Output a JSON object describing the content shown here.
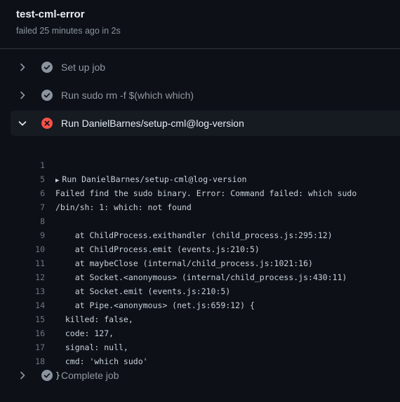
{
  "job": {
    "title": "test-cml-error",
    "subtitle": "failed 25 minutes ago in 2s"
  },
  "steps": [
    {
      "label": "Set up job",
      "status": "success",
      "expanded": false
    },
    {
      "label": "Run sudo rm -f $(which which)",
      "status": "success",
      "expanded": false
    },
    {
      "label": "Run DanielBarnes/setup-cml@log-version",
      "status": "failure",
      "expanded": true
    },
    {
      "label": "Complete job",
      "status": "success",
      "expanded": false
    }
  ],
  "colors": {
    "background": "#0d1117",
    "success_icon": "#8b949e",
    "failure_icon": "#f85149",
    "active_step_bg": "#161b22"
  },
  "log": {
    "group_header": "Run DanielBarnes/setup-cml@log-version",
    "lines": [
      {
        "num": "1",
        "text": "Run DanielBarnes/setup-cml@log-version"
      },
      {
        "num": "5",
        "text": "Failed find the sudo binary. Error: Command failed: which sudo"
      },
      {
        "num": "6",
        "text": "/bin/sh: 1: which: not found"
      },
      {
        "num": "7",
        "text": ""
      },
      {
        "num": "8",
        "text": "    at ChildProcess.exithandler (child_process.js:295:12)"
      },
      {
        "num": "9",
        "text": "    at ChildProcess.emit (events.js:210:5)"
      },
      {
        "num": "10",
        "text": "    at maybeClose (internal/child_process.js:1021:16)"
      },
      {
        "num": "11",
        "text": "    at Socket.<anonymous> (internal/child_process.js:430:11)"
      },
      {
        "num": "12",
        "text": "    at Socket.emit (events.js:210:5)"
      },
      {
        "num": "13",
        "text": "    at Pipe.<anonymous> (net.js:659:12) {"
      },
      {
        "num": "14",
        "text": "  killed: false,"
      },
      {
        "num": "15",
        "text": "  code: 127,"
      },
      {
        "num": "16",
        "text": "  signal: null,"
      },
      {
        "num": "17",
        "text": "  cmd: 'which sudo'"
      },
      {
        "num": "18",
        "text": "}"
      }
    ]
  }
}
